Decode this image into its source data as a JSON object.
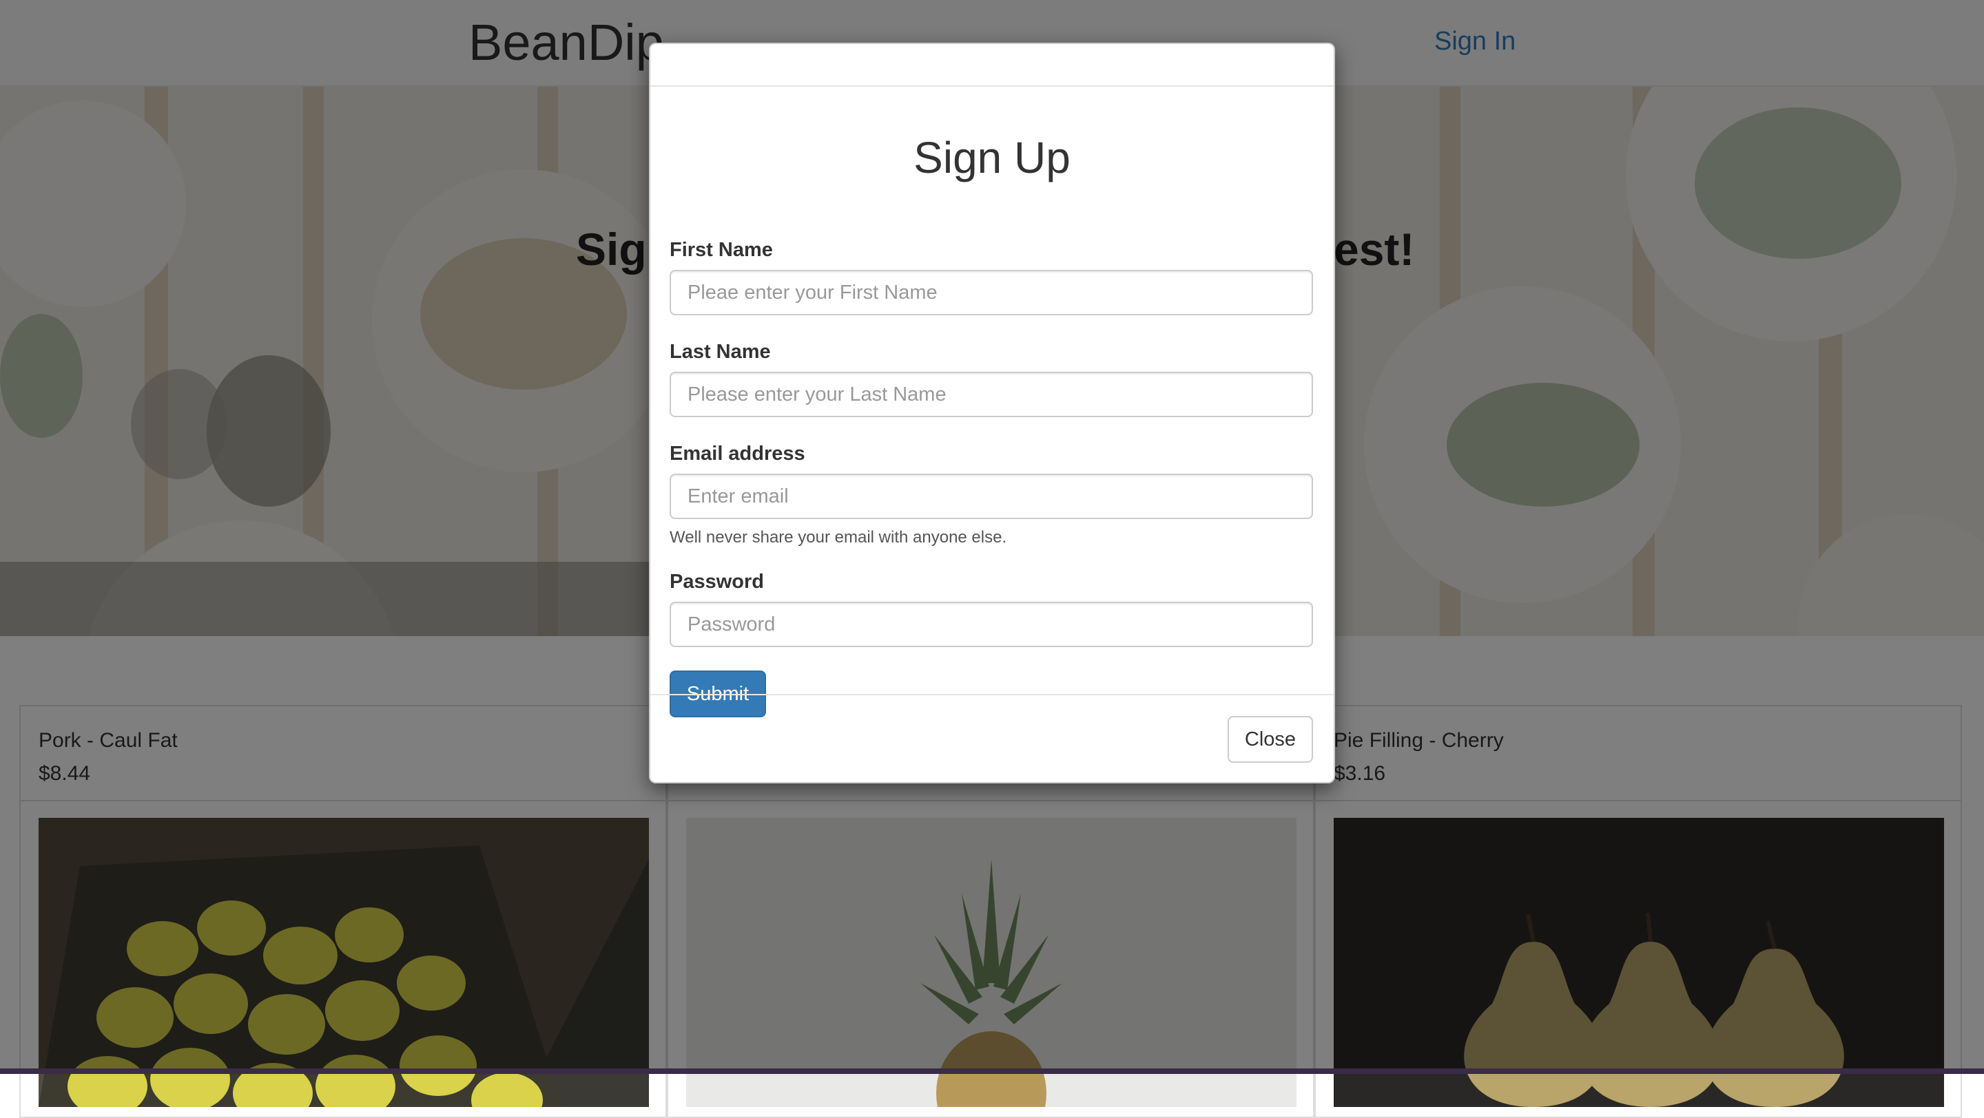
{
  "navbar": {
    "brand": "BeanDip",
    "sign_in": "Sign In"
  },
  "hero": {
    "heading_left": "Sign",
    "heading_right": "est!"
  },
  "products": [
    {
      "name": "Pork - Caul Fat",
      "price": "$8.44",
      "image": "lemons-in-crate"
    },
    {
      "name": "",
      "price": "",
      "image": "pineapple"
    },
    {
      "name": "Pie Filling - Cherry",
      "price": "$3.16",
      "image": "pears"
    }
  ],
  "modal": {
    "title": "Sign Up",
    "first_name_label": "First Name",
    "first_name_placeholder": "Pleae enter your First Name",
    "last_name_label": "Last Name",
    "last_name_placeholder": "Please enter your Last Name",
    "email_label": "Email address",
    "email_placeholder": "Enter email",
    "email_help": "Well never share your email with anyone else.",
    "password_label": "Password",
    "password_placeholder": "Password",
    "submit_label": "Submit",
    "close_label": "Close"
  },
  "colors": {
    "primary": "#337ab7",
    "link": "#337ab7",
    "backdrop": "rgba(0,0,0,0.5)"
  }
}
